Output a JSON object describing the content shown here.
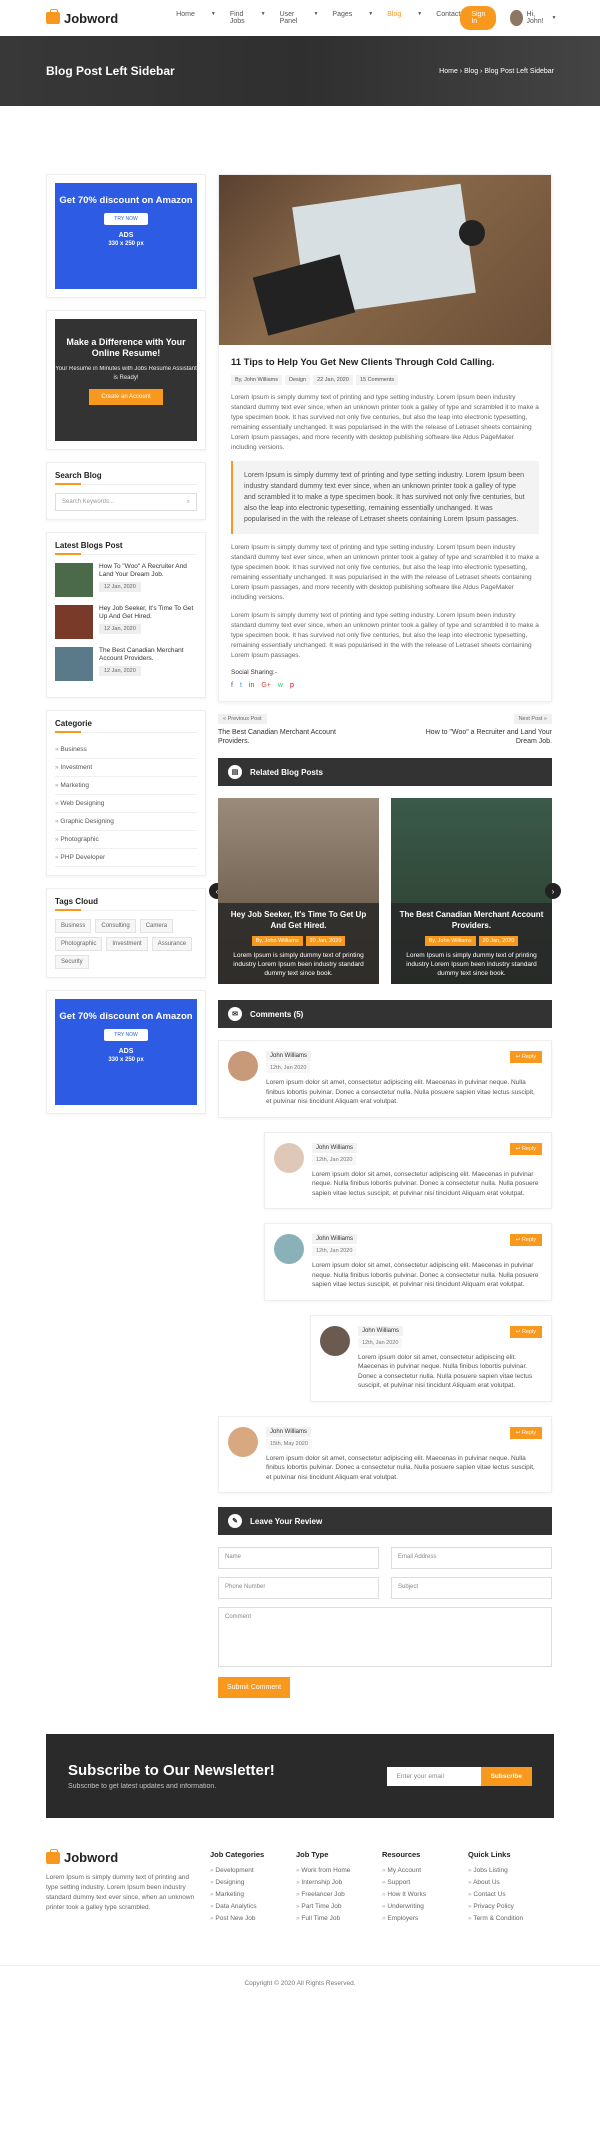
{
  "header": {
    "brand": "Jobword",
    "nav": [
      {
        "label": "Home",
        "active": false,
        "caret": true
      },
      {
        "label": "Find Jobs",
        "active": false,
        "caret": true
      },
      {
        "label": "User Panel",
        "active": false,
        "caret": true
      },
      {
        "label": "Pages",
        "active": false,
        "caret": true
      },
      {
        "label": "Blog",
        "active": true,
        "caret": true
      },
      {
        "label": "Contact",
        "active": false,
        "caret": false
      }
    ],
    "signin": "Sign In",
    "user": "Hi, John!"
  },
  "banner": {
    "title": "Blog Post Left Sidebar",
    "crumbs": [
      "Home",
      "Blog",
      "Blog Post Left Sidebar"
    ]
  },
  "ad": {
    "title": "Get 70% discount on Amazon",
    "button": "TRY NOW",
    "label": "ADS",
    "size": "330 x 250 px"
  },
  "promo": {
    "title": "Make a Difference with Your Online Resume!",
    "text": "Your Resume in Minutes with Jobs Resume Assistant is Ready!",
    "button": "Create an Account"
  },
  "search": {
    "heading": "Search Blog",
    "placeholder": "Search Keywords..."
  },
  "latest": {
    "heading": "Latest Blogs Post",
    "items": [
      {
        "title": "How To \"Woo\" A Recruiter And Land Your Dream Job.",
        "date": "12 Jan, 2020"
      },
      {
        "title": "Hey Job Seeker, It's Time To Get Up And Get Hired.",
        "date": "12 Jan, 2020"
      },
      {
        "title": "The Best Canadian Merchant Account Providers.",
        "date": "12 Jan, 2020"
      }
    ]
  },
  "categories": {
    "heading": "Categorie",
    "items": [
      "Business",
      "Investment",
      "Marketing",
      "Web Designing",
      "Graphic Designing",
      "Photographic",
      "PHP Developer"
    ]
  },
  "tags": {
    "heading": "Tags Cloud",
    "items": [
      "Business",
      "Consulting",
      "Camera",
      "Photographic",
      "Investment",
      "Assurance",
      "Security"
    ]
  },
  "post": {
    "title": "11 Tips to Help You Get New Clients Through Cold Calling.",
    "meta": [
      "By, John Williams",
      "Design",
      "22 Jan, 2020",
      "15 Comments"
    ],
    "p1": "Lorem Ipsum is simply dummy text of printing and type setting industry. Lorem Ipsum been industry standard dummy text ever since, when an unknown printer took a galley of type and scrambled it to make a type specimen book. It has survived not only five centuries, but also the leap into electronic typesetting, remaining essentially unchanged. It was popularised in the with the release of Letraset sheets containing Lorem Ipsum passages, and more recently with desktop publishing software like Aldus PageMaker including versions.",
    "quote": "Lorem Ipsum is simply dummy text of printing and type setting industry. Lorem Ipsum been industry standard dummy text ever since, when an unknown printer took a galley of type and scrambled it to make a type specimen book. It has survived not only five centuries, but also the leap into electronic typesetting, remaining essentially unchanged. It was popularised in the with the release of Letraset sheets containing Lorem Ipsum passages.",
    "p2": "Lorem Ipsum is simply dummy text of printing and type setting industry. Lorem Ipsum been industry standard dummy text ever since, when an unknown printer took a galley of type and scrambled it to make a type specimen book. It has survived not only five centuries, but also the leap into electronic typesetting, remaining essentially unchanged. It was popularised in the with the release of Letraset sheets containing Lorem Ipsum passages, and more recently with desktop publishing software like Aldus PageMaker including versions.",
    "p3": "Lorem Ipsum is simply dummy text of printing and type setting industry. Lorem Ipsum been industry standard dummy text ever since, when an unknown printer took a galley of type and scrambled it to make a type specimen book. It has survived not only five centuries, but also the leap into electronic typesetting, remaining essentially unchanged. It was popularised in the with the release of Letraset sheets containing Lorem Ipsum passages.",
    "social_label": "Social Sharing:-",
    "social": [
      "f",
      "t",
      "in",
      "G+",
      "w",
      "p"
    ]
  },
  "prevnext": {
    "prev_btn": "« Previous Post",
    "prev_title": "The Best Canadian Merchant Account Providers.",
    "next_btn": "Next Post »",
    "next_title": "How to \"Woo\" a Recruiter and Land Your Dream Job."
  },
  "related": {
    "heading": "Related Blog Posts",
    "items": [
      {
        "title": "Hey Job Seeker, It's Time To Get Up And Get Hired.",
        "author": "By, John Williams",
        "date": "20 Jan, 2020",
        "text": "Lorem Ipsum is simply dummy text of printing industry Lorem Ipsum been industry standard dummy text since book."
      },
      {
        "title": "The Best Canadian Merchant Account Providers.",
        "author": "By, John Williams",
        "date": "20 Jan, 2020",
        "text": "Lorem Ipsum is simply dummy text of printing industry Lorem Ipsum been industry standard dummy text since book."
      }
    ]
  },
  "comments": {
    "heading": "Comments (5)",
    "reply": "Reply",
    "items": [
      {
        "name": "John Williams",
        "date": "12th, Jan 2020",
        "text": "Lorem ipsum dolor sit amet, consectetur adipiscing elit. Maecenas in pulvinar neque. Nulla finibus lobortis pulvinar. Donec a consectetur nulla. Nulla posuere sapien vitae lectus suscipit, et pulvinar nisi tincidunt Aliquam erat volutpat.",
        "level": 0
      },
      {
        "name": "John Williams",
        "date": "12th, Jan 2020",
        "text": "Lorem ipsum dolor sit amet, consectetur adipiscing elit. Maecenas in pulvinar neque. Nulla finibus lobortis pulvinar. Donec a consectetur nulla. Nulla posuere sapien vitae lectus suscipit, et pulvinar nisi tincidunt Aliquam erat volutpat.",
        "level": 1
      },
      {
        "name": "John Williams",
        "date": "12th, Jan 2020",
        "text": "Lorem ipsum dolor sit amet, consectetur adipiscing elit. Maecenas in pulvinar neque. Nulla finibus lobortis pulvinar. Donec a consectetur nulla. Nulla posuere sapien vitae lectus suscipit, et pulvinar nisi tincidunt Aliquam erat volutpat.",
        "level": 1
      },
      {
        "name": "John Williams",
        "date": "12th, Jan 2020",
        "text": "Lorem ipsum dolor sit amet, consectetur adipiscing elit. Maecenas in pulvinar neque. Nulla finibus lobortis pulvinar. Donec a consectetur nulla. Nulla posuere sapien vitae lectus suscipit, et pulvinar nisi tincidunt Aliquam erat volutpat.",
        "level": 2
      },
      {
        "name": "John Williams",
        "date": "15th, May 2020",
        "text": "Lorem ipsum dolor sit amet, consectetur adipiscing elit. Maecenas in pulvinar neque. Nulla finibus lobortis pulvinar. Donec a consectetur nulla. Nulla posuere sapien vitae lectus suscipit, et pulvinar nisi tincidunt Aliquam erat volutpat.",
        "level": 0
      }
    ]
  },
  "review": {
    "heading": "Leave Your Review",
    "name": "Name",
    "email": "Email Address",
    "phone": "Phone Number",
    "subject": "Subject",
    "comment": "Comment",
    "submit": "Submit Comment"
  },
  "newsletter": {
    "title": "Subscribe to Our Newsletter!",
    "subtitle": "Subscribe to get latest updates and information.",
    "placeholder": "Enter your email",
    "button": "Subscribe"
  },
  "footer": {
    "brand": "Jobword",
    "about": "Lorem Ipsum is simply dummy text of printing and type setting industry. Lorem Ipsum been industry standard dummy text ever since, when an unknown printer took a galley type scrambled.",
    "cols": [
      {
        "title": "Job Categories",
        "links": [
          "Development",
          "Designing",
          "Marketing",
          "Data Analytics",
          "Post New Job"
        ]
      },
      {
        "title": "Job Type",
        "links": [
          "Work from Home",
          "Internship Job",
          "Freelancer Job",
          "Part Time Job",
          "Full Time Job"
        ]
      },
      {
        "title": "Resources",
        "links": [
          "My Account",
          "Support",
          "How It Works",
          "Underwriting",
          "Employers"
        ]
      },
      {
        "title": "Quick Links",
        "links": [
          "Jobs Listing",
          "About Us",
          "Contact Us",
          "Privacy Policy",
          "Term & Condition"
        ]
      }
    ],
    "copyright": "Copyright © 2020 All Rights Reserved."
  }
}
